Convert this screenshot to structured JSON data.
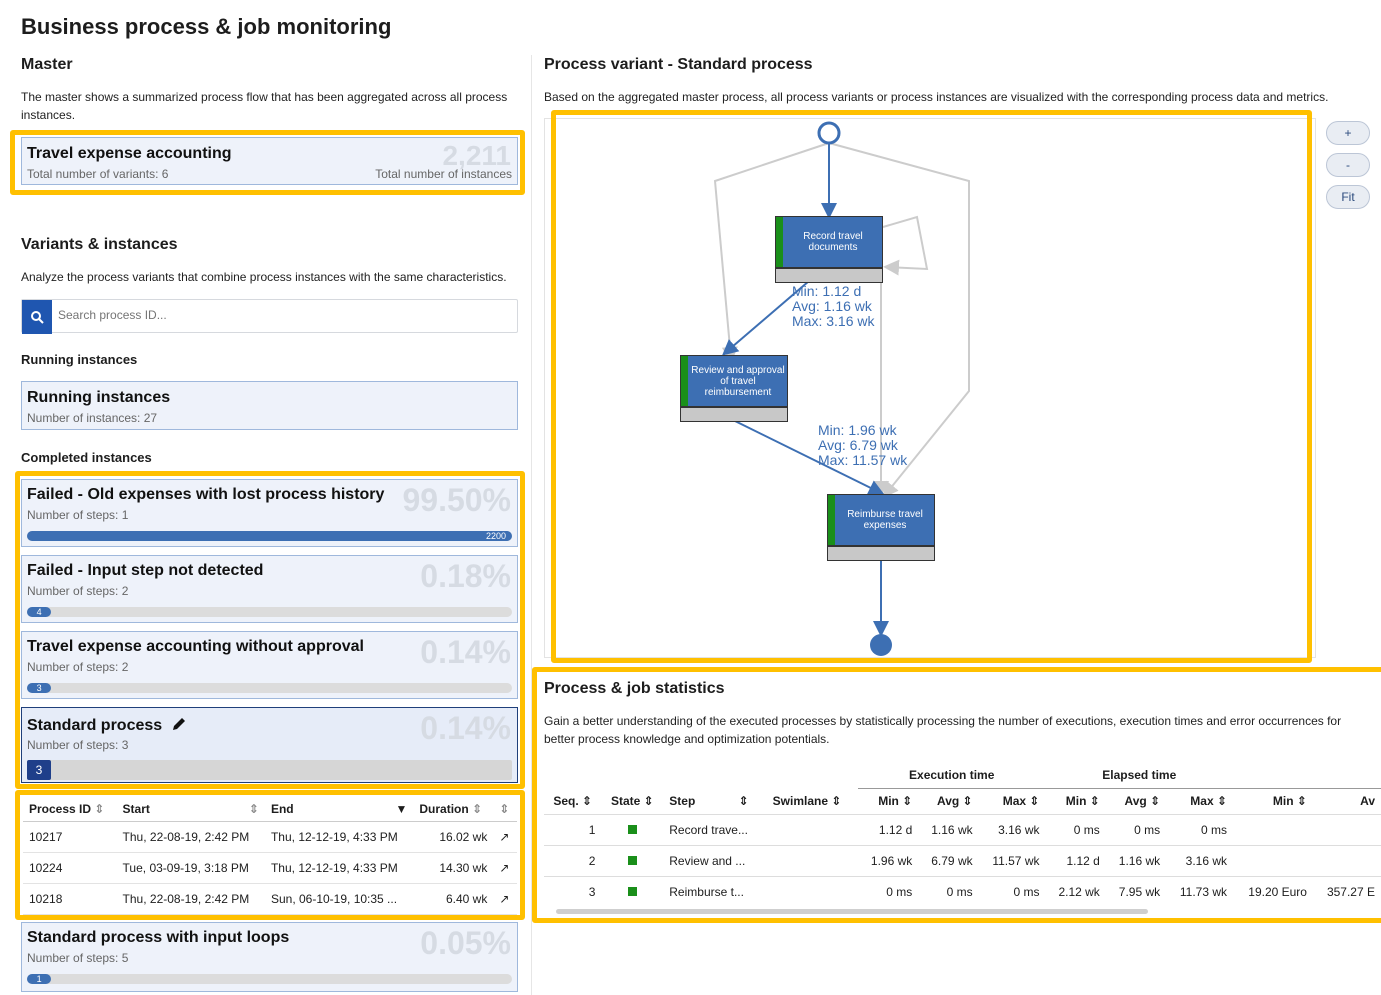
{
  "page_title": "Business process & job monitoring",
  "master": {
    "heading": "Master",
    "description": "The master shows a summarized process flow that has been aggregated across all process instances.",
    "card": {
      "title": "Travel expense accounting",
      "variants_label": "Total number of variants: 6",
      "total": "2,211",
      "total_label": "Total number of instances"
    }
  },
  "variants": {
    "heading": "Variants & instances",
    "description": "Analyze the process variants that combine process instances with the same characteristics.",
    "search_placeholder": "Search process ID...",
    "running_heading": "Running instances",
    "running_card": {
      "title": "Running instances",
      "sub": "Number of instances: 27"
    },
    "completed_heading": "Completed instances",
    "completed": [
      {
        "title": "Failed - Old expenses with lost process history",
        "sub": "Number of steps: 1",
        "pct": "99.50%",
        "bar_fraction": 1.0,
        "bar_label": "2200"
      },
      {
        "title": "Failed - Input step not detected",
        "sub": "Number of steps: 2",
        "pct": "0.18%",
        "bar_fraction": 0.05,
        "bar_label": "4"
      },
      {
        "title": "Travel expense accounting without approval",
        "sub": "Number of steps: 2",
        "pct": "0.14%",
        "bar_fraction": 0.05,
        "bar_label": "3"
      },
      {
        "title": "Standard process",
        "sub": "Number of steps: 3",
        "pct": "0.14%",
        "bar_fraction": 0.05,
        "bar_label": "3"
      },
      {
        "title": "Standard process with input loops",
        "sub": "Number of steps: 5",
        "pct": "0.05%",
        "bar_fraction": 0.05,
        "bar_label": "1"
      }
    ],
    "instances_table": {
      "headers": [
        "Process ID",
        "Start",
        "End",
        "Duration"
      ],
      "rows": [
        [
          "10217",
          "Thu, 22-08-19, 2:42 PM",
          "Thu, 12-12-19, 4:33 PM",
          "16.02 wk"
        ],
        [
          "10224",
          "Tue, 03-09-19, 3:18 PM",
          "Thu, 12-12-19, 4:33 PM",
          "14.30 wk"
        ],
        [
          "10218",
          "Thu, 22-08-19, 2:42 PM",
          "Sun, 06-10-19, 10:35 ...",
          "6.40 wk"
        ]
      ]
    }
  },
  "variant": {
    "heading": "Process variant - Standard process",
    "description": "Based on the aggregated master process, all process variants or process instances are visualized with the corresponding process data and metrics.",
    "zoom_in": "+",
    "zoom_out": "-",
    "fit": "Fit",
    "nodes": [
      {
        "label": "Record travel documents"
      },
      {
        "label": "Review and approval of travel reimbursement"
      },
      {
        "label": "Reimburse travel expenses"
      }
    ],
    "edge1": {
      "min": "Min: 1.12 d",
      "avg": "Avg: 1.16 wk",
      "max": "Max: 3.16 wk"
    },
    "edge2": {
      "min": "Min: 1.96 wk",
      "avg": "Avg: 6.79 wk",
      "max": "Max: 11.57 wk"
    }
  },
  "stats": {
    "heading": "Process & job statistics",
    "description": "Gain a better understanding of the executed processes by statistically processing the number of executions, execution times and error occurrences for better process knowledge and optimization potentials.",
    "group_execution": "Execution time",
    "group_elapsed": "Elapsed time",
    "headers": [
      "Seq.",
      "State",
      "Step",
      "Swimlane",
      "Min",
      "Avg",
      "Max",
      "Min",
      "Avg",
      "Max",
      "Min",
      "Av"
    ],
    "rows": [
      [
        "1",
        "",
        "Record trave...",
        "",
        "1.12 d",
        "1.16 wk",
        "3.16 wk",
        "0 ms",
        "0 ms",
        "0 ms",
        "",
        ""
      ],
      [
        "2",
        "",
        "Review and ...",
        "",
        "1.96 wk",
        "6.79 wk",
        "11.57 wk",
        "1.12 d",
        "1.16 wk",
        "3.16 wk",
        "",
        ""
      ],
      [
        "3",
        "",
        "Reimburse t...",
        "",
        "0 ms",
        "0 ms",
        "0 ms",
        "2.12 wk",
        "7.95 wk",
        "11.73 wk",
        "19.20 Euro",
        "357.27 E"
      ]
    ],
    "state_color": "#1a8f1a"
  },
  "colors": {
    "accent": "#3d6fb3",
    "highlight": "#ffc000",
    "search_button": "#1f56b0"
  }
}
